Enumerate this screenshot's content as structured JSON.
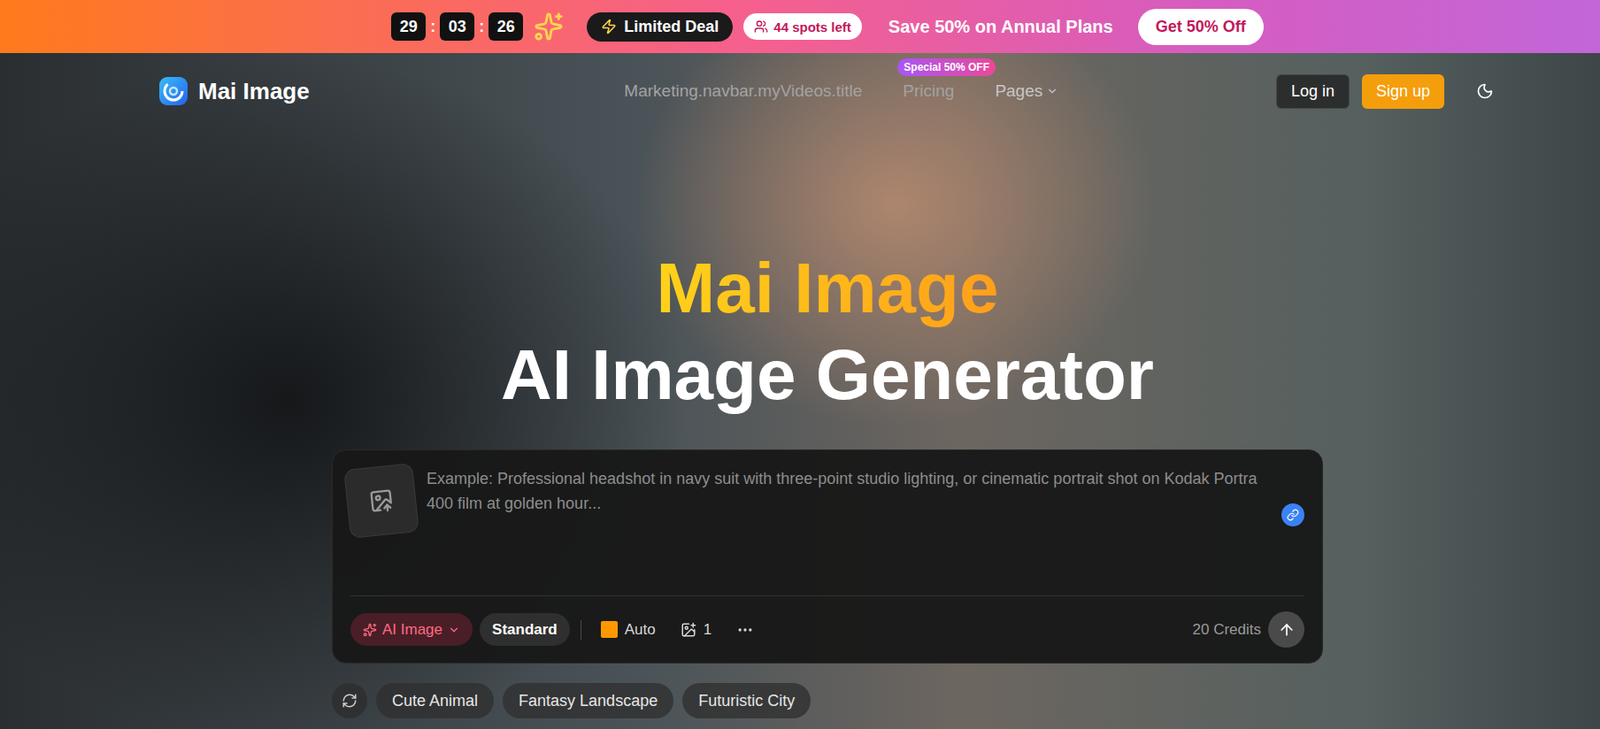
{
  "banner": {
    "timer": [
      "29",
      "03",
      "26"
    ],
    "separator": ":",
    "deal": "Limited Deal",
    "spots": "44 spots left",
    "message": "Save 50% on Annual Plans",
    "cta": "Get 50% Off"
  },
  "navbar": {
    "brand": "Mai Image",
    "links": [
      {
        "label": "Marketing.navbar.myVideos.title",
        "badge": "",
        "has_menu": false
      },
      {
        "label": "Pricing",
        "badge": "Special 50% OFF",
        "has_menu": false
      },
      {
        "label": "Pages",
        "badge": "",
        "has_menu": true
      }
    ],
    "login": "Log in",
    "signup": "Sign up"
  },
  "hero": {
    "title": "Mai Image",
    "subtitle": "AI Image Generator"
  },
  "prompt": {
    "placeholder": "Example: Professional headshot in navy suit with three-point studio lighting, or cinematic portrait shot on Kodak Portra 400 film at golden hour...",
    "mode": "AI Image",
    "quality": "Standard",
    "aspect": "Auto",
    "count": "1",
    "credits": "20 Credits"
  },
  "suggestions": [
    "Cute Animal",
    "Fantasy Landscape",
    "Futuristic City"
  ]
}
